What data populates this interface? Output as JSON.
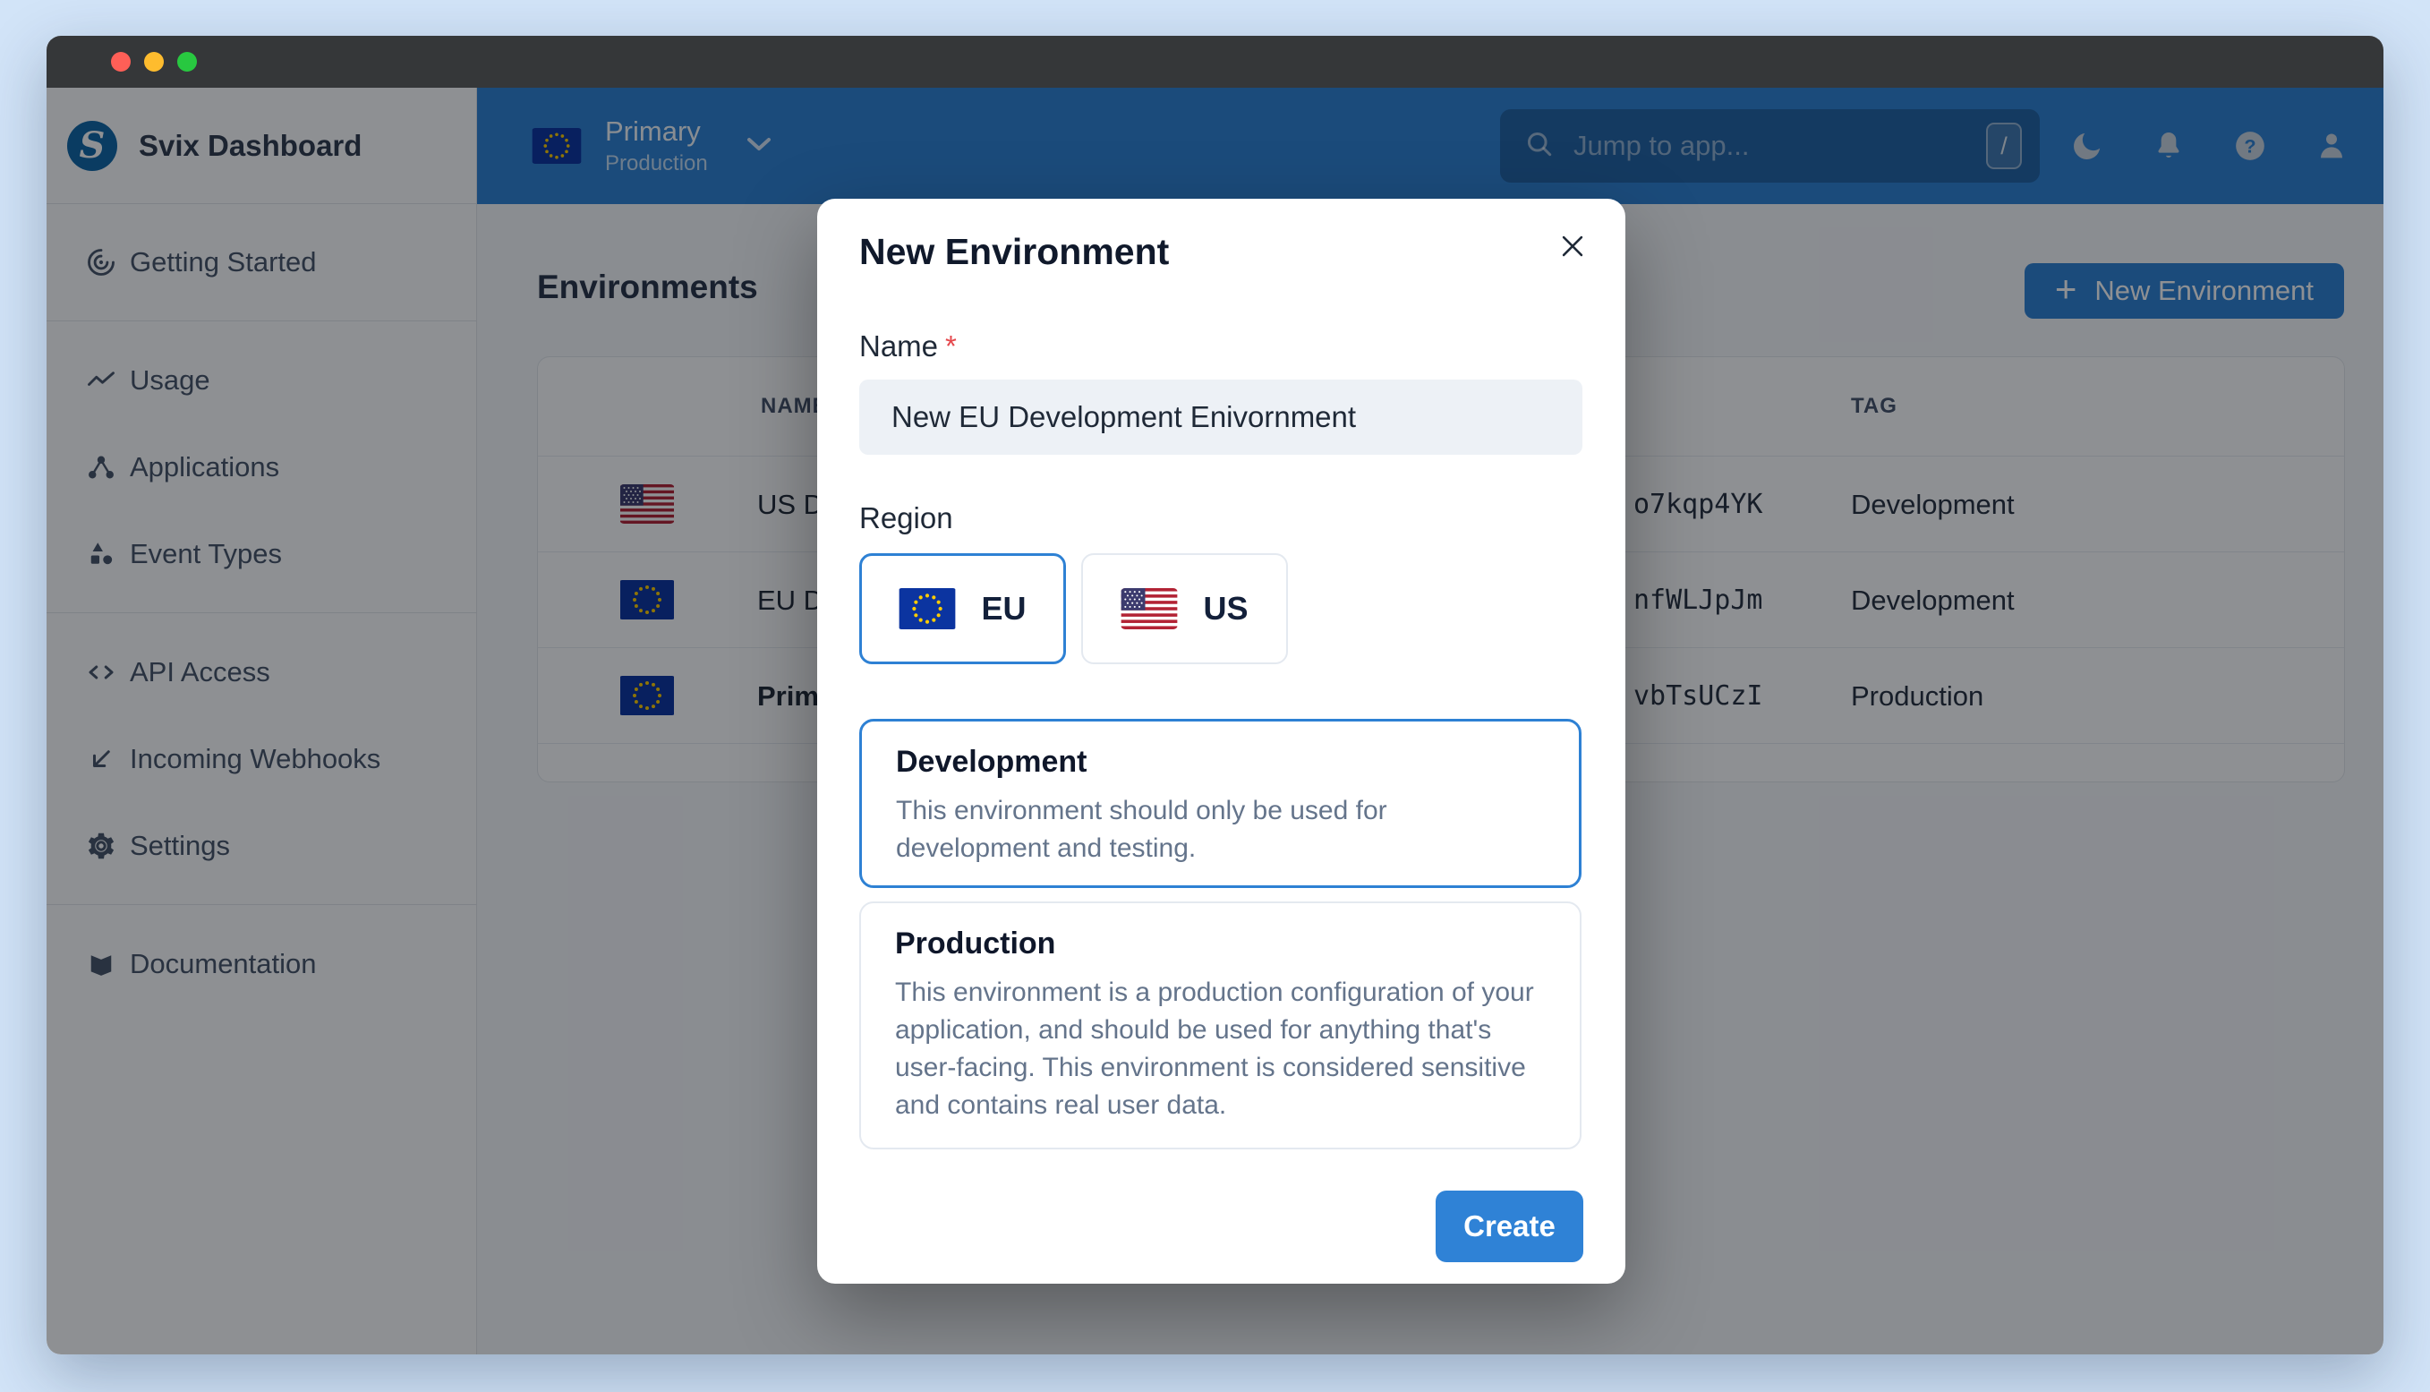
{
  "window": {
    "controls": [
      "close",
      "minimize",
      "maximize"
    ]
  },
  "sidebar": {
    "logo_letter": "S",
    "logo_text": "Svix Dashboard",
    "items": [
      {
        "icon": "getting-started-icon",
        "label": "Getting Started",
        "group": 1
      },
      {
        "icon": "usage-icon",
        "label": "Usage",
        "group": 2
      },
      {
        "icon": "applications-icon",
        "label": "Applications",
        "group": 2
      },
      {
        "icon": "event-types-icon",
        "label": "Event Types",
        "group": 2
      },
      {
        "icon": "api-access-icon",
        "label": "API Access",
        "group": 3
      },
      {
        "icon": "incoming-webhooks-icon",
        "label": "Incoming Webhooks",
        "group": 3
      },
      {
        "icon": "settings-icon",
        "label": "Settings",
        "group": 3
      },
      {
        "icon": "documentation-icon",
        "label": "Documentation",
        "group": 4
      }
    ]
  },
  "topbar": {
    "env_name": "Primary",
    "env_tag": "Production",
    "env_flag": "eu",
    "search_placeholder": "Jump to app...",
    "search_shortcut": "/",
    "icons": [
      "moon-icon",
      "bell-icon",
      "help-icon",
      "user-icon"
    ]
  },
  "page": {
    "title": "Environments",
    "new_environment_button": "New Environment",
    "table": {
      "columns": [
        "NAME",
        "TAG"
      ],
      "rows": [
        {
          "flag": "us",
          "name": "US D",
          "code": "o7kqp4YK",
          "tag": "Development"
        },
        {
          "flag": "eu",
          "name": "EU D",
          "code": "nfWLJpJm",
          "tag": "Development"
        },
        {
          "flag": "eu",
          "name": "Prim",
          "code": "vbTsUCzI",
          "tag": "Production"
        }
      ]
    }
  },
  "modal": {
    "title": "New Environment",
    "name_label": "Name",
    "required_mark": "*",
    "name_value": "New EU Development Enivornment",
    "region_label": "Region",
    "regions": [
      {
        "label": "EU",
        "flag": "eu",
        "selected": true
      },
      {
        "label": "US",
        "flag": "us",
        "selected": false
      }
    ],
    "env_types": [
      {
        "title": "Development",
        "description": "This environment should only be used for development and testing.",
        "selected": true
      },
      {
        "title": "Production",
        "description": "This environment is a production configuration of your application, and should be used for anything that's user-facing. This environment is considered sensitive and contains real user data.",
        "selected": false
      }
    ],
    "create_button": "Create"
  },
  "colors": {
    "accent": "#2e81d4",
    "topbar": "#2e81d4",
    "titlebar": "#353739",
    "desktop": "#d2e4f8",
    "eu_flag_blue": "#0b34a0",
    "us_flag_red": "#b22234",
    "us_flag_blue": "#3c3b6e",
    "required_red": "#e5484d"
  }
}
